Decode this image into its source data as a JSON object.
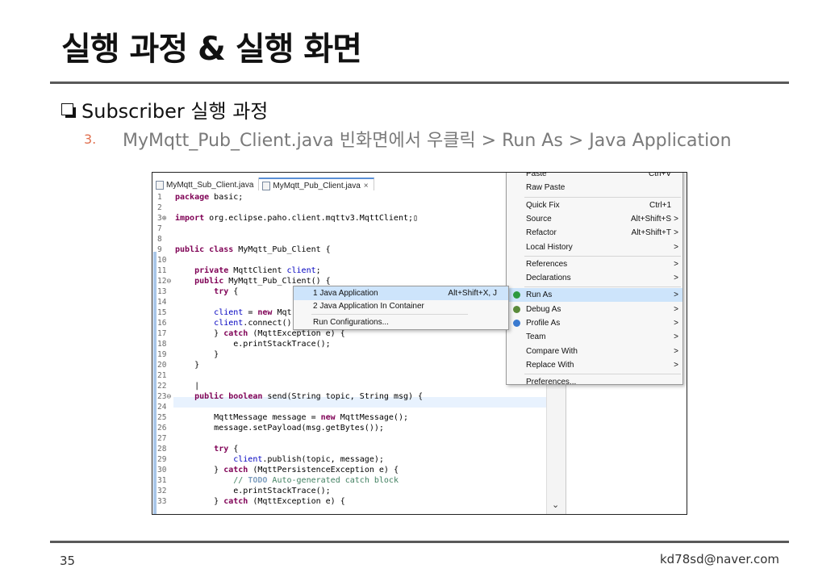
{
  "slide": {
    "title": "실행 과정 & 실행 화면",
    "bullet": "Subscriber 실행 과정",
    "step_number": "3.",
    "step_text": "MyMqtt_Pub_Client.java 빈화면에서 우클릭 > Run As > Java Application",
    "page_number": "35",
    "email": "kd78sd@naver.com"
  },
  "tabs": [
    {
      "label": "MyMqtt_Sub_Client.java"
    },
    {
      "label": "MyMqtt_Pub_Client.java",
      "close": "×"
    }
  ],
  "code_lines": [
    {
      "n": "1",
      "html": "<span class='kw'>package</span> basic;"
    },
    {
      "n": "2",
      "html": ""
    },
    {
      "n": "3⊕",
      "html": "<span class='kw'>import</span> org.eclipse.paho.client.mqttv3.MqttClient;▯"
    },
    {
      "n": "7",
      "html": ""
    },
    {
      "n": "8",
      "html": ""
    },
    {
      "n": "9",
      "html": "<span class='kw'>public class</span> MyMqtt_Pub_Client {"
    },
    {
      "n": "10",
      "html": ""
    },
    {
      "n": "11",
      "html": "    <span class='kw'>private</span> MqttClient <span class='fld'>client</span>;"
    },
    {
      "n": "12⊖",
      "html": "    <span class='kw'>public</span> MyMqtt_Pub_Client() {"
    },
    {
      "n": "13",
      "html": "        <span class='kw'>try</span> {"
    },
    {
      "n": "14",
      "html": ""
    },
    {
      "n": "15",
      "html": "        <span class='fld'>client</span> = <span class='kw'>new</span> Mqt"
    },
    {
      "n": "16",
      "html": "        <span class='fld'>client</span>.connect()"
    },
    {
      "n": "17",
      "html": "        } <span class='kw'>catch</span> (MqttException e) {"
    },
    {
      "n": "18",
      "html": "            e.printStackTrace();"
    },
    {
      "n": "19",
      "html": "        }"
    },
    {
      "n": "20",
      "html": "    }"
    },
    {
      "n": "21",
      "html": ""
    },
    {
      "n": "22",
      "html": "    |"
    },
    {
      "n": "23⊖",
      "html": "    <span class='kw'>public boolean</span> send(String topic, String msg) {"
    },
    {
      "n": "24",
      "html": ""
    },
    {
      "n": "25",
      "html": "        MqttMessage message = <span class='kw'>new</span> MqttMessage();"
    },
    {
      "n": "26",
      "html": "        message.setPayload(msg.getBytes());"
    },
    {
      "n": "27",
      "html": ""
    },
    {
      "n": "28",
      "html": "        <span class='kw'>try</span> {"
    },
    {
      "n": "29",
      "html": "            <span class='fld'>client</span>.publish(topic, message);"
    },
    {
      "n": "30",
      "html": "        } <span class='kw'>catch</span> (MqttPersistenceException e) {"
    },
    {
      "n": "31",
      "html": "            <span class='cm'>// <span class='cmkw'>TODO</span> Auto-generated catch block</span>"
    },
    {
      "n": "32",
      "html": "            e.printStackTrace();"
    },
    {
      "n": "33",
      "html": "        } <span class='kw'>catch</span> (MqttException e) {"
    }
  ],
  "context_menu": [
    {
      "label": "Paste",
      "shortcut": "Ctrl+V",
      "type": "item"
    },
    {
      "label": "Raw Paste",
      "type": "item"
    },
    {
      "type": "sep"
    },
    {
      "label": "Quick Fix",
      "shortcut": "Ctrl+1",
      "type": "item"
    },
    {
      "label": "Source",
      "shortcut": "Alt+Shift+S",
      "arrow": ">",
      "type": "item"
    },
    {
      "label": "Refactor",
      "shortcut": "Alt+Shift+T",
      "arrow": ">",
      "type": "item"
    },
    {
      "label": "Local History",
      "arrow": ">",
      "type": "item"
    },
    {
      "type": "sep"
    },
    {
      "label": "References",
      "arrow": ">",
      "type": "item"
    },
    {
      "label": "Declarations",
      "arrow": ">",
      "type": "item"
    },
    {
      "type": "sep"
    },
    {
      "label": "Run As",
      "arrow": ">",
      "type": "item",
      "selected": true,
      "icon": "#2e9a3e"
    },
    {
      "label": "Debug As",
      "arrow": ">",
      "type": "item",
      "icon": "#5a8a3a"
    },
    {
      "label": "Profile As",
      "arrow": ">",
      "type": "item",
      "icon": "#3a7ad0"
    },
    {
      "label": "Team",
      "arrow": ">",
      "type": "item"
    },
    {
      "label": "Compare With",
      "arrow": ">",
      "type": "item"
    },
    {
      "label": "Replace With",
      "arrow": ">",
      "type": "item"
    },
    {
      "type": "sep"
    },
    {
      "label": "Preferences...",
      "type": "item"
    }
  ],
  "submenu": [
    {
      "label": "1 Java Application",
      "shortcut": "Alt+Shift+X, J",
      "selected": true,
      "type": "item"
    },
    {
      "label": "2 Java Application In Container",
      "type": "item"
    },
    {
      "type": "sep"
    },
    {
      "label": "Run Configurations...",
      "type": "item"
    }
  ],
  "colors": {
    "accent": "#cde4fb",
    "step_number": "#e07050",
    "keyword": "#7f0055"
  }
}
